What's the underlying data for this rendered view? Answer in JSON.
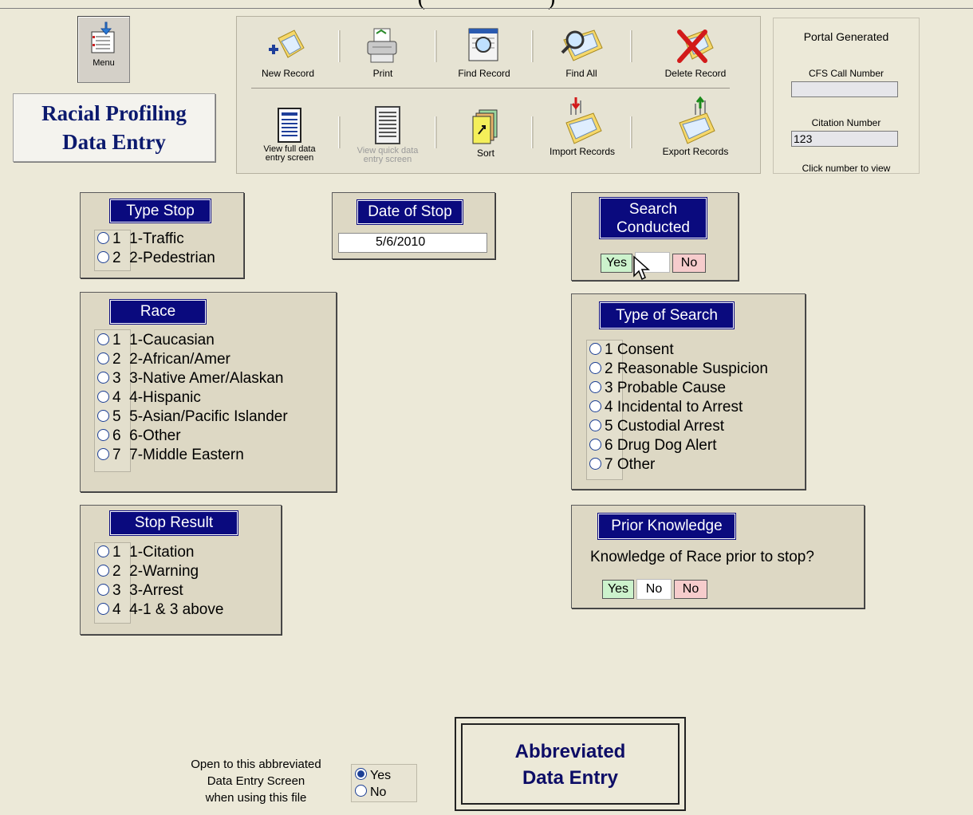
{
  "menu": {
    "label": "Menu"
  },
  "app_title": {
    "line1": "Racial Profiling",
    "line2": "Data Entry"
  },
  "toolbar": {
    "new_record": "New Record",
    "print": "Print",
    "find_record": "Find Record",
    "find_all": "Find All",
    "delete_record": "Delete Record",
    "view_full_line1": "View full data",
    "view_full_line2": "entry screen",
    "view_quick_line1": "View quick data",
    "view_quick_line2": "entry screen",
    "sort": "Sort",
    "import_records": "Import Records",
    "export_records": "Export Records"
  },
  "portal": {
    "title": "Portal Generated",
    "cfs_label": "CFS Call Number",
    "cfs_value": "",
    "citation_label": "Citation Number",
    "citation_value": "123",
    "hint": "Click number to view"
  },
  "type_stop": {
    "title": "Type Stop",
    "options": [
      {
        "num": "1",
        "label": "1-Traffic"
      },
      {
        "num": "2",
        "label": "2-Pedestrian"
      }
    ]
  },
  "date_of_stop": {
    "title": "Date of Stop",
    "value": "5/6/2010"
  },
  "search_conducted": {
    "title_line1": "Search",
    "title_line2": "Conducted",
    "yes": "Yes",
    "value": "",
    "no": "No"
  },
  "race": {
    "title": "Race",
    "options": [
      {
        "num": "1",
        "label": "1-Caucasian"
      },
      {
        "num": "2",
        "label": "2-African/Amer"
      },
      {
        "num": "3",
        "label": "3-Native Amer/Alaskan"
      },
      {
        "num": "4",
        "label": "4-Hispanic"
      },
      {
        "num": "5",
        "label": "5-Asian/Pacific Islander"
      },
      {
        "num": "6",
        "label": "6-Other"
      },
      {
        "num": "7",
        "label": "7-Middle Eastern"
      }
    ]
  },
  "type_of_search": {
    "title": "Type of Search",
    "options": [
      {
        "num": "1",
        "label": "Consent"
      },
      {
        "num": "2",
        "label": "Reasonable Suspicion"
      },
      {
        "num": "3",
        "label": "Probable Cause"
      },
      {
        "num": "4",
        "label": "Incidental to Arrest"
      },
      {
        "num": "5",
        "label": "Custodial Arrest"
      },
      {
        "num": "6",
        "label": "Drug Dog Alert"
      },
      {
        "num": "7",
        "label": "Other"
      }
    ]
  },
  "stop_result": {
    "title": "Stop Result",
    "options": [
      {
        "num": "1",
        "label": "1-Citation"
      },
      {
        "num": "2",
        "label": "2-Warning"
      },
      {
        "num": "3",
        "label": "3-Arrest"
      },
      {
        "num": "4",
        "label": "4-1 & 3 above"
      }
    ]
  },
  "prior_knowledge": {
    "title": "Prior Knowledge",
    "question": "Knowledge of Race prior to stop?",
    "yes": "Yes",
    "value": "No",
    "no": "No"
  },
  "open_setting": {
    "line1": "Open to this abbreviated",
    "line2": "Data Entry Screen",
    "line3": "when using this file",
    "yes": "Yes",
    "no": "No",
    "selected": "Yes"
  },
  "abbrev_button": {
    "line1": "Abbreviated",
    "line2": "Data Entry"
  }
}
